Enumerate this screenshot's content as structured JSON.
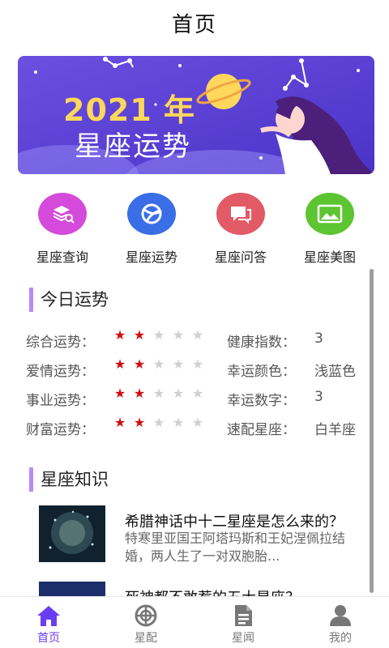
{
  "header": {
    "title": "首页"
  },
  "banner": {
    "year_text": "2021 年",
    "line2": "星座运势"
  },
  "categories": [
    {
      "label": "星座查询",
      "icon": "stack-search-icon",
      "color": "#d44bdc"
    },
    {
      "label": "星座运势",
      "icon": "orbit-icon",
      "color": "#3a6ee6"
    },
    {
      "label": "星座问答",
      "icon": "chat-icon",
      "color": "#e15a65"
    },
    {
      "label": "星座美图",
      "icon": "image-icon",
      "color": "#5cc531"
    }
  ],
  "today": {
    "title": "今日运势",
    "rows": [
      {
        "label": "综合运势：",
        "stars": 2,
        "max_stars": 5,
        "label2": "健康指数：",
        "value2": "3"
      },
      {
        "label": "爱情运势：",
        "stars": 2,
        "max_stars": 5,
        "label2": "幸运颜色：",
        "value2": "浅蓝色"
      },
      {
        "label": "事业运势：",
        "stars": 2,
        "max_stars": 5,
        "label2": "幸运数字：",
        "value2": "3"
      },
      {
        "label": "财富运势：",
        "stars": 2,
        "max_stars": 5,
        "label2": "速配星座：",
        "value2": "白羊座"
      }
    ]
  },
  "knowledge": {
    "title": "星座知识",
    "articles": [
      {
        "title": "希腊神话中十二星座是怎么来的？",
        "summary": "特寒里亚国王阿塔玛斯和王妃涅佩拉结婚，两人生了一对双胞胎..."
      },
      {
        "title": "死神都不敢惹的五大星座？",
        "summary": ""
      }
    ]
  },
  "tabs": [
    {
      "label": "首页",
      "icon": "home-icon",
      "active": true
    },
    {
      "label": "星配",
      "icon": "target-icon",
      "active": false
    },
    {
      "label": "星闻",
      "icon": "news-icon",
      "active": false
    },
    {
      "label": "我的",
      "icon": "user-icon",
      "active": false
    }
  ],
  "colors": {
    "accent": "#6a3df0",
    "star_on": "#d00d10",
    "star_off": "#cfcfcf",
    "section_bar": "#b98bf7"
  }
}
